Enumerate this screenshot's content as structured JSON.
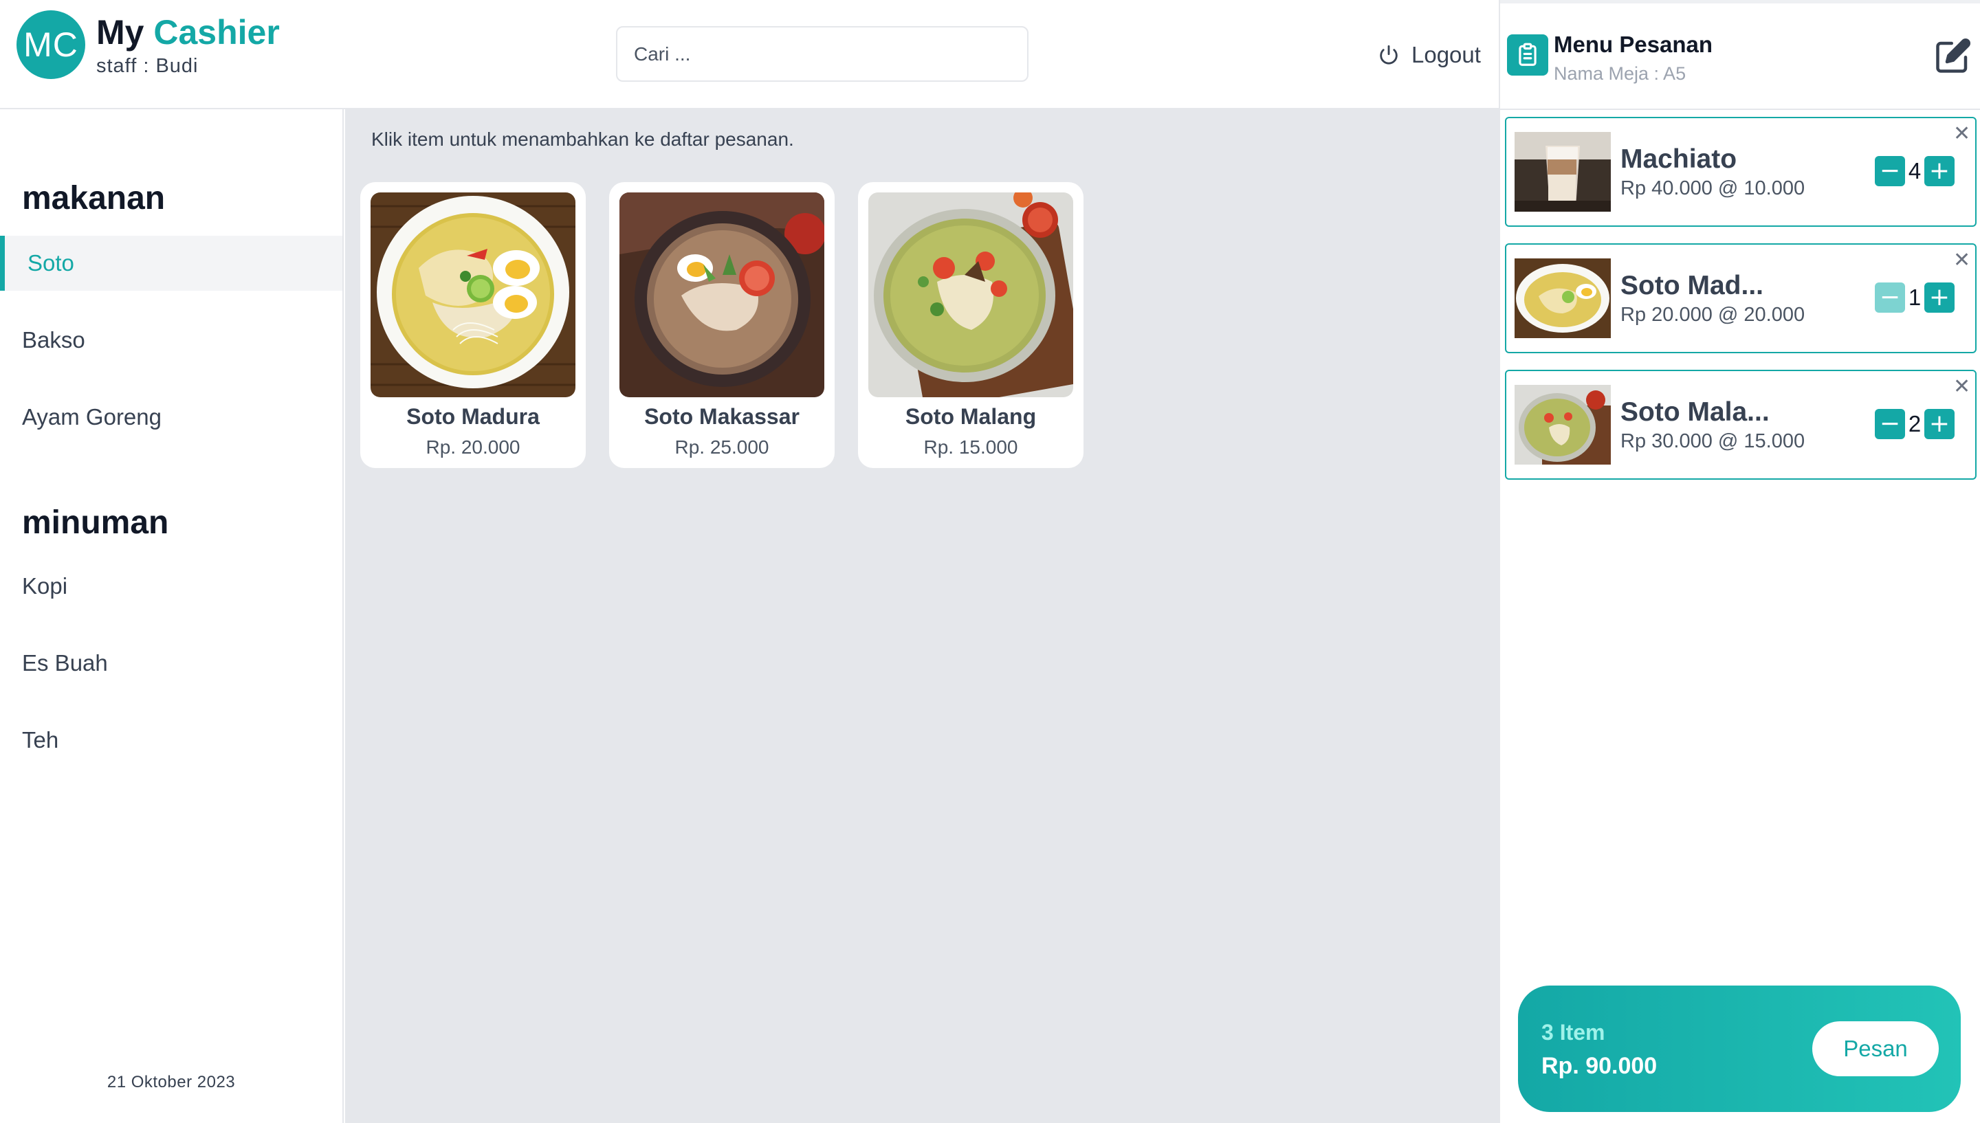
{
  "header": {
    "logo_initials": "MC",
    "title_prefix": "My",
    "title_accent": "Cashier",
    "staff": "staff : Budi",
    "search_placeholder": "Cari ...",
    "logout_label": "Logout"
  },
  "sidebar": {
    "categories": [
      {
        "heading": "makanan",
        "items": [
          {
            "label": "Soto",
            "active": true
          },
          {
            "label": "Bakso"
          },
          {
            "label": "Ayam Goreng"
          }
        ]
      },
      {
        "heading": "minuman",
        "items": [
          {
            "label": "Kopi"
          },
          {
            "label": "Es Buah"
          },
          {
            "label": "Teh"
          }
        ]
      }
    ],
    "date": "21 Oktober 2023"
  },
  "main": {
    "hint": "Klik item untuk menambahkan ke daftar pesanan.",
    "products": [
      {
        "name": "Soto Madura",
        "price": "Rp. 20.000"
      },
      {
        "name": "Soto Makassar",
        "price": "Rp. 25.000"
      },
      {
        "name": "Soto Malang",
        "price": "Rp. 15.000"
      }
    ]
  },
  "order": {
    "title": "Menu Pesanan",
    "table": "Nama Meja : A5",
    "items": [
      {
        "name": "Machiato",
        "price_line": "Rp 40.000 @ 10.000",
        "qty": "4"
      },
      {
        "name": "Soto Mad...",
        "price_line": "Rp 20.000 @ 20.000",
        "qty": "1"
      },
      {
        "name": "Soto Mala...",
        "price_line": "Rp 30.000 @ 15.000",
        "qty": "2"
      }
    ],
    "summary_count": "3 Item",
    "summary_total": "Rp. 90.000",
    "submit_label": "Pesan"
  },
  "colors": {
    "accent": "#14a8a6",
    "main_bg": "#e5e7eb"
  }
}
